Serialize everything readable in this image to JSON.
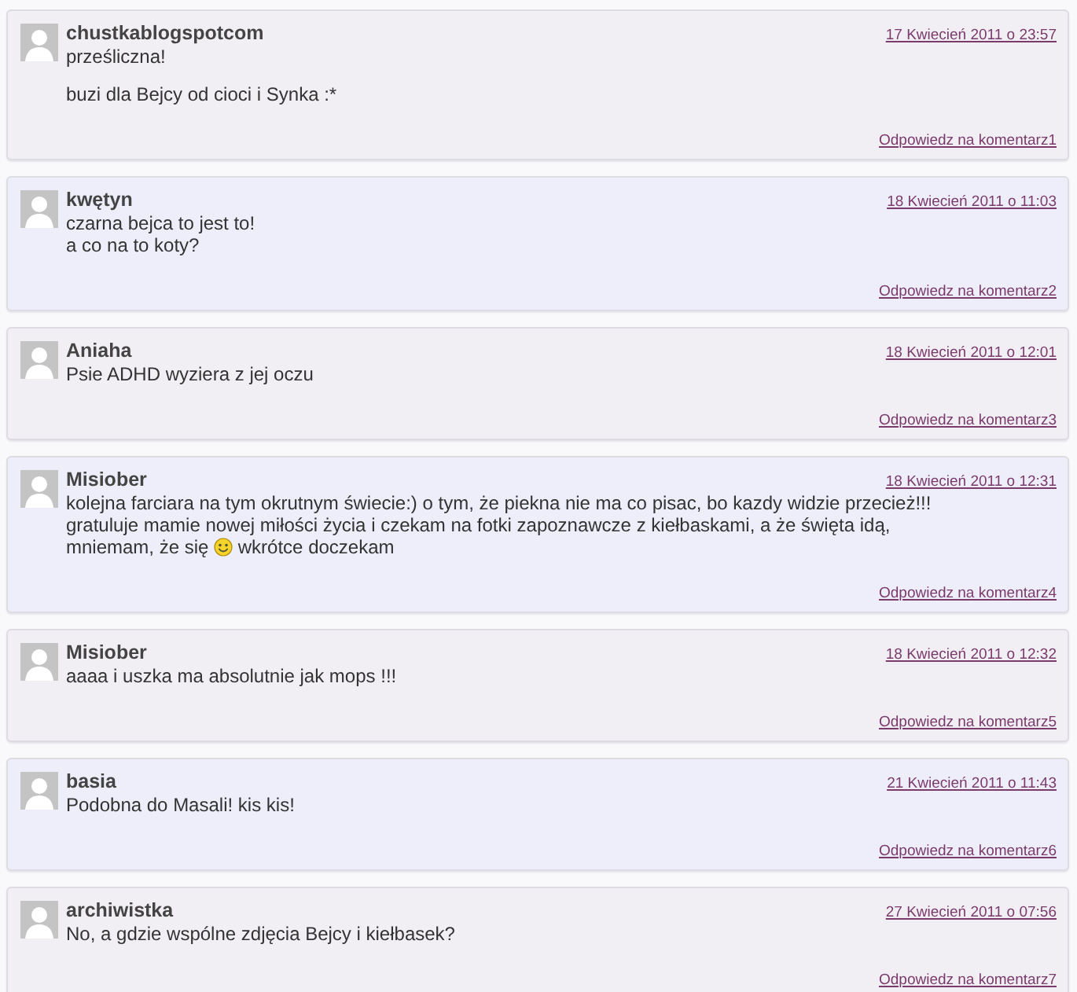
{
  "comments": [
    {
      "author": "chustkablogspotcom",
      "date": "17 Kwiecień 2011 o 23:57",
      "body": [
        [
          {
            "kind": "text",
            "text": "prześliczna!"
          }
        ],
        [
          {
            "kind": "text",
            "text": "buzi dla Bejcy od cioci i Synka :*"
          }
        ]
      ],
      "reply": "Odpowiedz na komentarz1"
    },
    {
      "author": "kwętyn",
      "date": "18 Kwiecień 2011 o 11:03",
      "body": [
        [
          {
            "kind": "text",
            "text": "czarna bejca to jest to!"
          },
          {
            "kind": "break"
          },
          {
            "kind": "text",
            "text": "a co na to koty?"
          }
        ]
      ],
      "reply": "Odpowiedz na komentarz2"
    },
    {
      "author": "Aniaha",
      "date": "18 Kwiecień 2011 o 12:01",
      "body": [
        [
          {
            "kind": "text",
            "text": "Psie ADHD wyziera z jej oczu"
          }
        ]
      ],
      "reply": "Odpowiedz na komentarz3"
    },
    {
      "author": "Misiober",
      "date": "18 Kwiecień 2011 o 12:31",
      "body": [
        [
          {
            "kind": "text",
            "text": "kolejna farciara na tym okrutnym świecie:) o tym, że piekna nie ma co pisac, bo kazdy widzie przecież!!!"
          },
          {
            "kind": "break"
          },
          {
            "kind": "text",
            "text": "gratuluje mamie nowej miłości życia i czekam na fotki zapoznawcze z kiełbaskami, a że święta idą, mniemam, że się"
          },
          {
            "kind": "smiley"
          },
          {
            "kind": "text",
            "text": "wkrótce doczekam"
          }
        ]
      ],
      "reply": "Odpowiedz na komentarz4"
    },
    {
      "author": "Misiober",
      "date": "18 Kwiecień 2011 o 12:32",
      "body": [
        [
          {
            "kind": "text",
            "text": "aaaa i uszka ma absolutnie jak mops !!!"
          }
        ]
      ],
      "reply": "Odpowiedz na komentarz5"
    },
    {
      "author": "basia",
      "date": "21 Kwiecień 2011 o 11:43",
      "body": [
        [
          {
            "kind": "text",
            "text": "Podobna do Masali! kis kis!"
          }
        ]
      ],
      "reply": "Odpowiedz na komentarz6"
    },
    {
      "author": "archiwistka",
      "date": "27 Kwiecień 2011 o 07:56",
      "body": [
        [
          {
            "kind": "text",
            "text": "No, a gdzie wspólne zdjęcia Bejcy i kiełbasek?"
          }
        ]
      ],
      "reply": "Odpowiedz na komentarz7"
    }
  ]
}
